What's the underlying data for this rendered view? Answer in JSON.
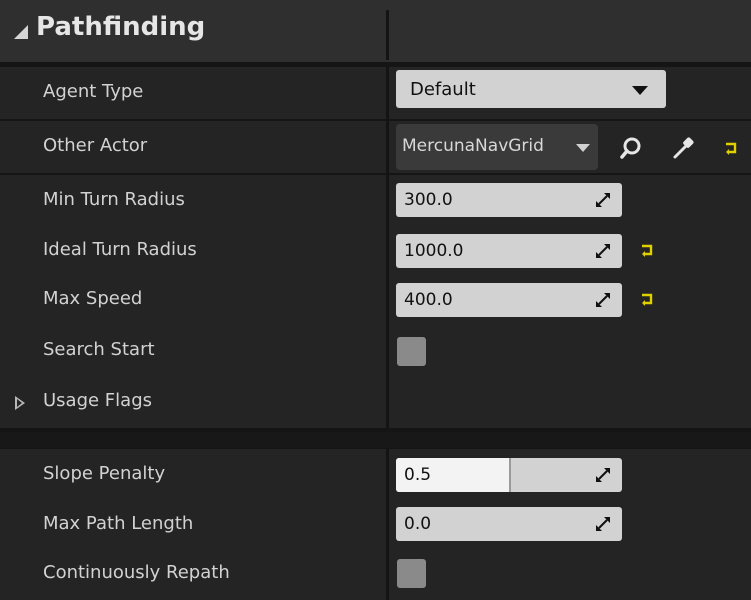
{
  "section": {
    "title": "Pathfinding"
  },
  "rows": {
    "agent_type": {
      "label": "Agent Type",
      "value": "Default"
    },
    "other_actor": {
      "label": "Other Actor",
      "value": "MercunaNavGrid"
    },
    "min_turn_radius": {
      "label": "Min Turn Radius",
      "value": "300.0"
    },
    "ideal_turn_radius": {
      "label": "Ideal Turn Radius",
      "value": "1000.0"
    },
    "max_speed": {
      "label": "Max Speed",
      "value": "400.0"
    },
    "search_start": {
      "label": "Search Start",
      "checked": false
    },
    "usage_flags": {
      "label": "Usage Flags"
    },
    "slope_penalty": {
      "label": "Slope Penalty",
      "value": "0.5",
      "fill_fraction": 0.5
    },
    "max_path_length": {
      "label": "Max Path Length",
      "value": "0.0"
    },
    "continuously_repath": {
      "label": "Continuously Repath",
      "checked": false
    }
  },
  "colors": {
    "reset_arrow": "#e0d000",
    "field_bg": "#d2d2d2",
    "panel_bg": "#242424",
    "header_bg": "#2f2f2f"
  },
  "icons": {
    "search": "search-icon",
    "picker": "eyedropper-icon",
    "reset": "reset-to-default-icon",
    "spin": "drag-arrows-icon",
    "expand": "expand-triangle-icon",
    "collapse": "collapse-triangle-icon"
  }
}
